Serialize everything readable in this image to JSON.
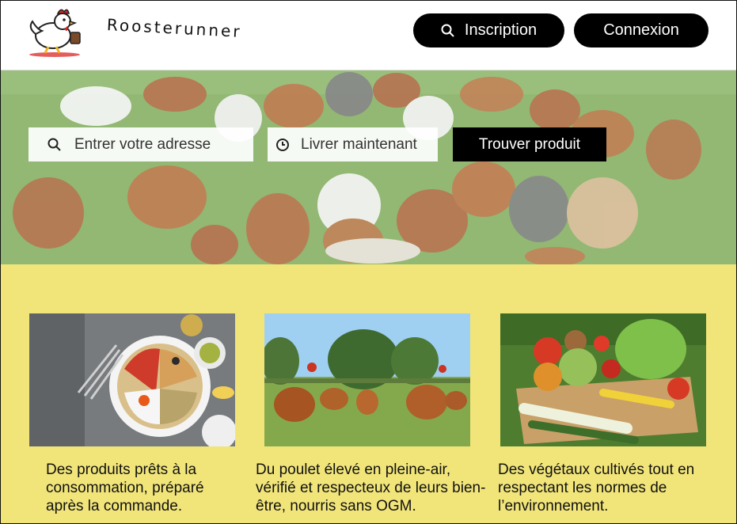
{
  "header": {
    "brand": "Roosterunner",
    "inscription_label": "Inscription",
    "connexion_label": "Connexion"
  },
  "search": {
    "address_placeholder": "Entrer votre adresse",
    "time_value": "Livrer maintenant",
    "find_label": "Trouver produit"
  },
  "cards": [
    {
      "text": "Des produits prêts à la consommation, préparé après la commande."
    },
    {
      "text": "Du poulet élevé en pleine-air, vérifié et respecteux de leurs bien-être, nourris sans OGM."
    },
    {
      "text": "Des végétaux cultivés tout en respectant les normes de l’environnement."
    }
  ],
  "colors": {
    "background": "#f1e57a",
    "button": "#000000",
    "header": "#ffffff"
  }
}
